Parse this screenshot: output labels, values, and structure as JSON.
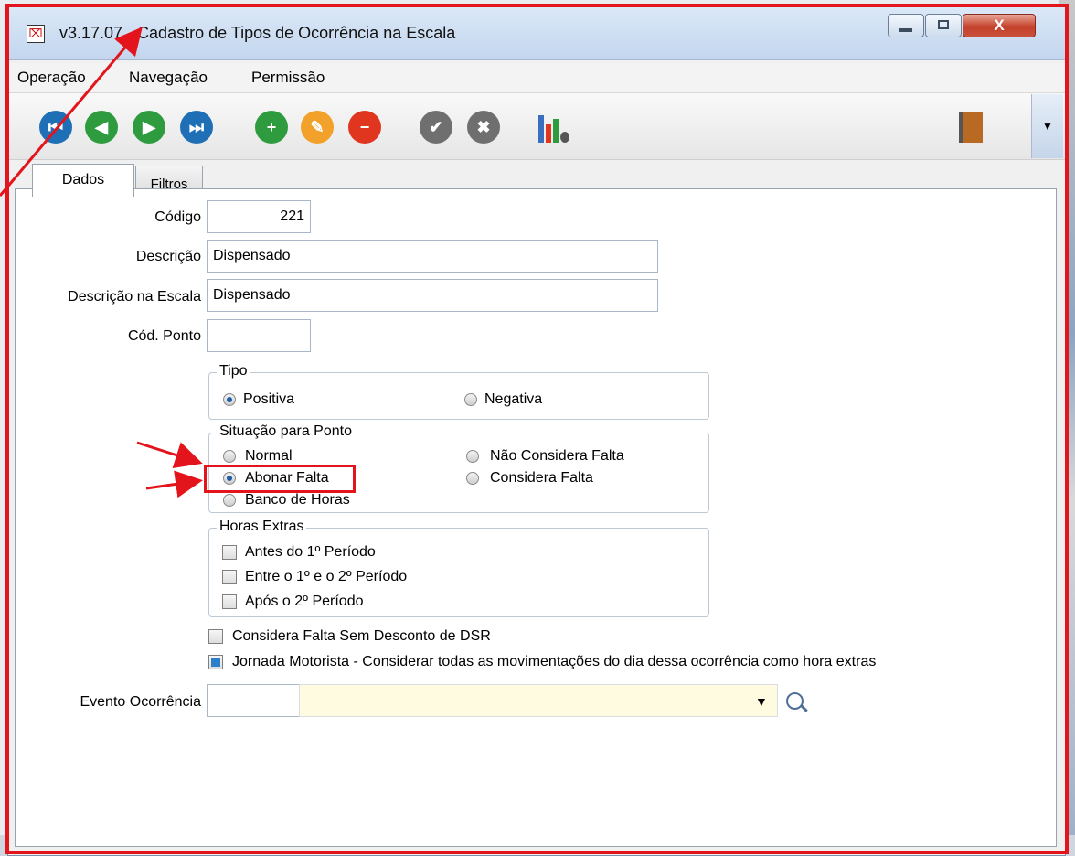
{
  "window": {
    "title": "v3.17.07 - Cadastro de Tipos de Ocorrência na Escala",
    "close_glyph": "X"
  },
  "menu": [
    "Operação",
    "Navegação",
    "Permissão"
  ],
  "toolbar": {
    "buttons": [
      "first-record",
      "previous-record",
      "next-record",
      "last-record",
      "add",
      "edit",
      "delete",
      "confirm",
      "cancel",
      "report-settings",
      "exit"
    ]
  },
  "tabs": {
    "dados": "Dados",
    "filtros": "Filtros"
  },
  "form": {
    "codigo_label": "Código",
    "codigo_value": "221",
    "descricao_label": "Descrição",
    "descricao_value": "Dispensado",
    "descricao_escala_label": "Descrição na Escala",
    "descricao_escala_value": "Dispensado",
    "cod_ponto_label": "Cód. Ponto",
    "cod_ponto_value": "",
    "tipo": {
      "title": "Tipo",
      "positiva": "Positiva",
      "negativa": "Negativa",
      "selected": "Positiva"
    },
    "situacao": {
      "title": "Situação para Ponto",
      "normal": "Normal",
      "abonar": "Abonar Falta",
      "banco": "Banco de Horas",
      "nao_considera": "Não Considera Falta",
      "considera": "Considera Falta",
      "selected": "Abonar Falta"
    },
    "horas_extras": {
      "title": "Horas Extras",
      "antes": "Antes do 1º Período",
      "entre": "Entre o 1º e o 2º Período",
      "apos": "Após o 2º Período"
    },
    "considera_dsr": "Considera Falta Sem Desconto de DSR",
    "jornada_motorista": "Jornada Motorista - Considerar todas as movimentações do dia dessa ocorrência como hora extras",
    "evento_label": "Evento Ocorrência",
    "evento_code": "",
    "evento_desc": ""
  },
  "colors": {
    "annotation": "#e3141b",
    "nav_blue": "#1f6fb6",
    "action_green": "#2e9c3e",
    "edit_orange": "#f2a12a",
    "delete_red": "#e0351f"
  }
}
